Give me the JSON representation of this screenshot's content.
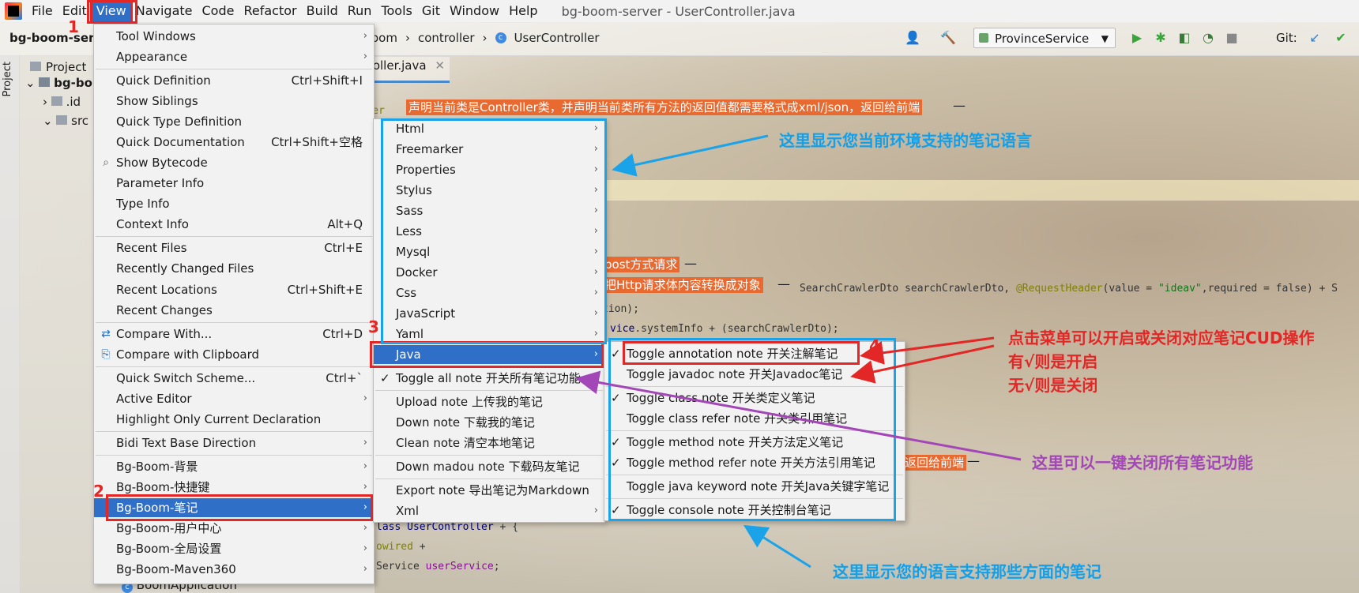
{
  "menubar": {
    "items": [
      "File",
      "Edit",
      "View",
      "Navigate",
      "Code",
      "Refactor",
      "Build",
      "Run",
      "Tools",
      "Git",
      "Window",
      "Help"
    ],
    "active": "View",
    "window_title": "bg-boom-server - UserController.java"
  },
  "toolbar": {
    "project_name": "bg-boom-serv",
    "breadcrumb": [
      "oom",
      "controller",
      "UserController"
    ],
    "run_config": "ProvinceService",
    "git_label": "Git:"
  },
  "project_panel": {
    "side_tab": "Project",
    "header": "Project",
    "tree": [
      "bg-bo",
      ".id",
      "src",
      "BoomApplication"
    ]
  },
  "editor": {
    "tab_label": "roller.java",
    "code_lines": {
      "ann_controller": "roller",
      "line_search": "SearchCrawlerDto searchCrawlerDto, ",
      "line_request_header": "@RequestHeader",
      "line_value": "(value = ",
      "line_ideav": "\"ideav\"",
      "line_required": ",required = false) ",
      "line_tail": "S",
      "line_tion": "tion);",
      "line_vice": "vice",
      "line_system": ".systemInfo ",
      "line_system_tail": "(searchCrawlerDto);",
      "line_class": "lass UserController ",
      "line_class_tail": "{",
      "line_owired": "owired ",
      "line_service": "Service ",
      "line_user_service": "userService",
      "line_service_tail": ";"
    },
    "notes": {
      "top": "声明当前类是Controller类，并声明当前类所有方法的返回值都需要格式成xml/json，返回给前端",
      "post": "post方式请求",
      "body": "把Http请求体内容转换成对象",
      "lower": "返回给前端"
    }
  },
  "view_menu": {
    "items": [
      {
        "label": "Tool Windows",
        "submenu": true
      },
      {
        "label": "Appearance",
        "submenu": true
      },
      {
        "label": "Quick Definition",
        "shortcut": "Ctrl+Shift+I"
      },
      {
        "label": "Show Siblings"
      },
      {
        "label": "Quick Type Definition"
      },
      {
        "label": "Quick Documentation",
        "shortcut": "Ctrl+Shift+空格"
      },
      {
        "label": "Show Bytecode"
      },
      {
        "label": "Parameter Info"
      },
      {
        "label": "Type Info"
      },
      {
        "label": "Context Info",
        "shortcut": "Alt+Q"
      },
      {
        "label": "Recent Files",
        "shortcut": "Ctrl+E"
      },
      {
        "label": "Recently Changed Files"
      },
      {
        "label": "Recent Locations",
        "shortcut": "Ctrl+Shift+E"
      },
      {
        "label": "Recent Changes"
      },
      {
        "label": "Compare With...",
        "shortcut": "Ctrl+D"
      },
      {
        "label": "Compare with Clipboard"
      },
      {
        "label": "Quick Switch Scheme...",
        "shortcut": "Ctrl+`"
      },
      {
        "label": "Active Editor",
        "submenu": true
      },
      {
        "label": "Highlight Only Current Declaration"
      },
      {
        "label": "Bidi Text Base Direction",
        "submenu": true
      },
      {
        "label": "Bg-Boom-背景",
        "submenu": true
      },
      {
        "label": "Bg-Boom-快捷键",
        "submenu": true
      },
      {
        "label": "Bg-Boom-笔记",
        "submenu": true
      },
      {
        "label": "Bg-Boom-用户中心",
        "submenu": true
      },
      {
        "label": "Bg-Boom-全局设置",
        "submenu": true
      },
      {
        "label": "Bg-Boom-Maven360",
        "submenu": true
      }
    ]
  },
  "notes_menu": {
    "items": [
      {
        "label": "Html",
        "submenu": true
      },
      {
        "label": "Freemarker",
        "submenu": true
      },
      {
        "label": "Properties",
        "submenu": true
      },
      {
        "label": "Stylus",
        "submenu": true
      },
      {
        "label": "Sass",
        "submenu": true
      },
      {
        "label": "Less",
        "submenu": true
      },
      {
        "label": "Mysql",
        "submenu": true
      },
      {
        "label": "Docker",
        "submenu": true
      },
      {
        "label": "Css",
        "submenu": true
      },
      {
        "label": "JavaScript",
        "submenu": true
      },
      {
        "label": "Yaml",
        "submenu": true
      },
      {
        "label": "Java",
        "submenu": true
      },
      {
        "label": "Toggle all note 开关所有笔记功能",
        "checked": true
      },
      {
        "label": "Upload note 上传我的笔记"
      },
      {
        "label": "Down note 下载我的笔记"
      },
      {
        "label": "Clean note 清空本地笔记"
      },
      {
        "label": "Down madou note 下载码友笔记"
      },
      {
        "label": "Export note 导出笔记为Markdown"
      },
      {
        "label": "Xml",
        "submenu": true
      }
    ]
  },
  "java_menu": {
    "items": [
      {
        "label": "Toggle annotation note 开关注解笔记",
        "checked": true
      },
      {
        "label": "Toggle javadoc note 开关Javadoc笔记",
        "checked": false
      },
      {
        "label": "Toggle class note  开关类定义笔记",
        "checked": true
      },
      {
        "label": "Toggle class refer note  开关类引用笔记",
        "checked": false
      },
      {
        "label": "Toggle method note  开关方法定义笔记",
        "checked": true
      },
      {
        "label": "Toggle method refer note  开关方法引用笔记",
        "checked": true
      },
      {
        "label": "Toggle java keyword note 开关Java关键字笔记",
        "checked": false
      },
      {
        "label": "Toggle console note 开关控制台笔记",
        "checked": true
      }
    ]
  },
  "annotations": {
    "num1": "1",
    "num2": "2",
    "num3": "3",
    "num4": "4",
    "lang_hint": "这里显示您当前环境支持的笔记语言",
    "toggle_hint_1": "点击菜单可以开启或关闭对应笔记CUD操作",
    "toggle_hint_2": "有√则是开启",
    "toggle_hint_3": "无√则是关闭",
    "all_hint": "这里可以一键关闭所有笔记功能",
    "aspect_hint": "这里显示您的语言支持那些方面的笔记"
  },
  "colors": {
    "selection": "#2f6fc7",
    "annotation_red": "#e32626",
    "annotation_blue": "#12a0ea",
    "annotation_purple": "#a347b8",
    "note_tag": "#e96a31"
  }
}
